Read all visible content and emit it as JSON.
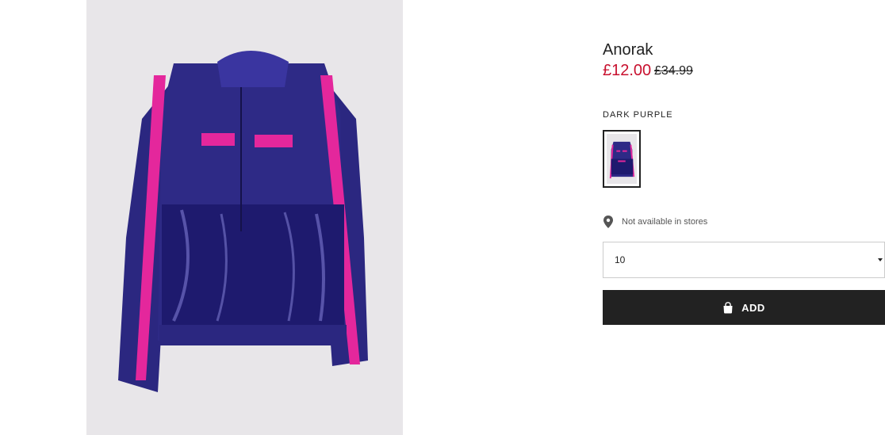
{
  "product": {
    "name": "Anorak",
    "price": "£12.00",
    "old_price": "£34.99",
    "color_label": "DARK PURPLE",
    "swatch_icon": "product-thumbnail",
    "store_availability": "Not available in stores",
    "store_icon": "location-pin-icon",
    "size_selected": "10",
    "add_button_label": "ADD",
    "add_icon": "shopping-bag-icon"
  },
  "colors": {
    "sale_red": "#c8102e",
    "button_bg": "#222222",
    "jacket_purple": "#2e2a86",
    "stripe_pink": "#e4279c"
  }
}
